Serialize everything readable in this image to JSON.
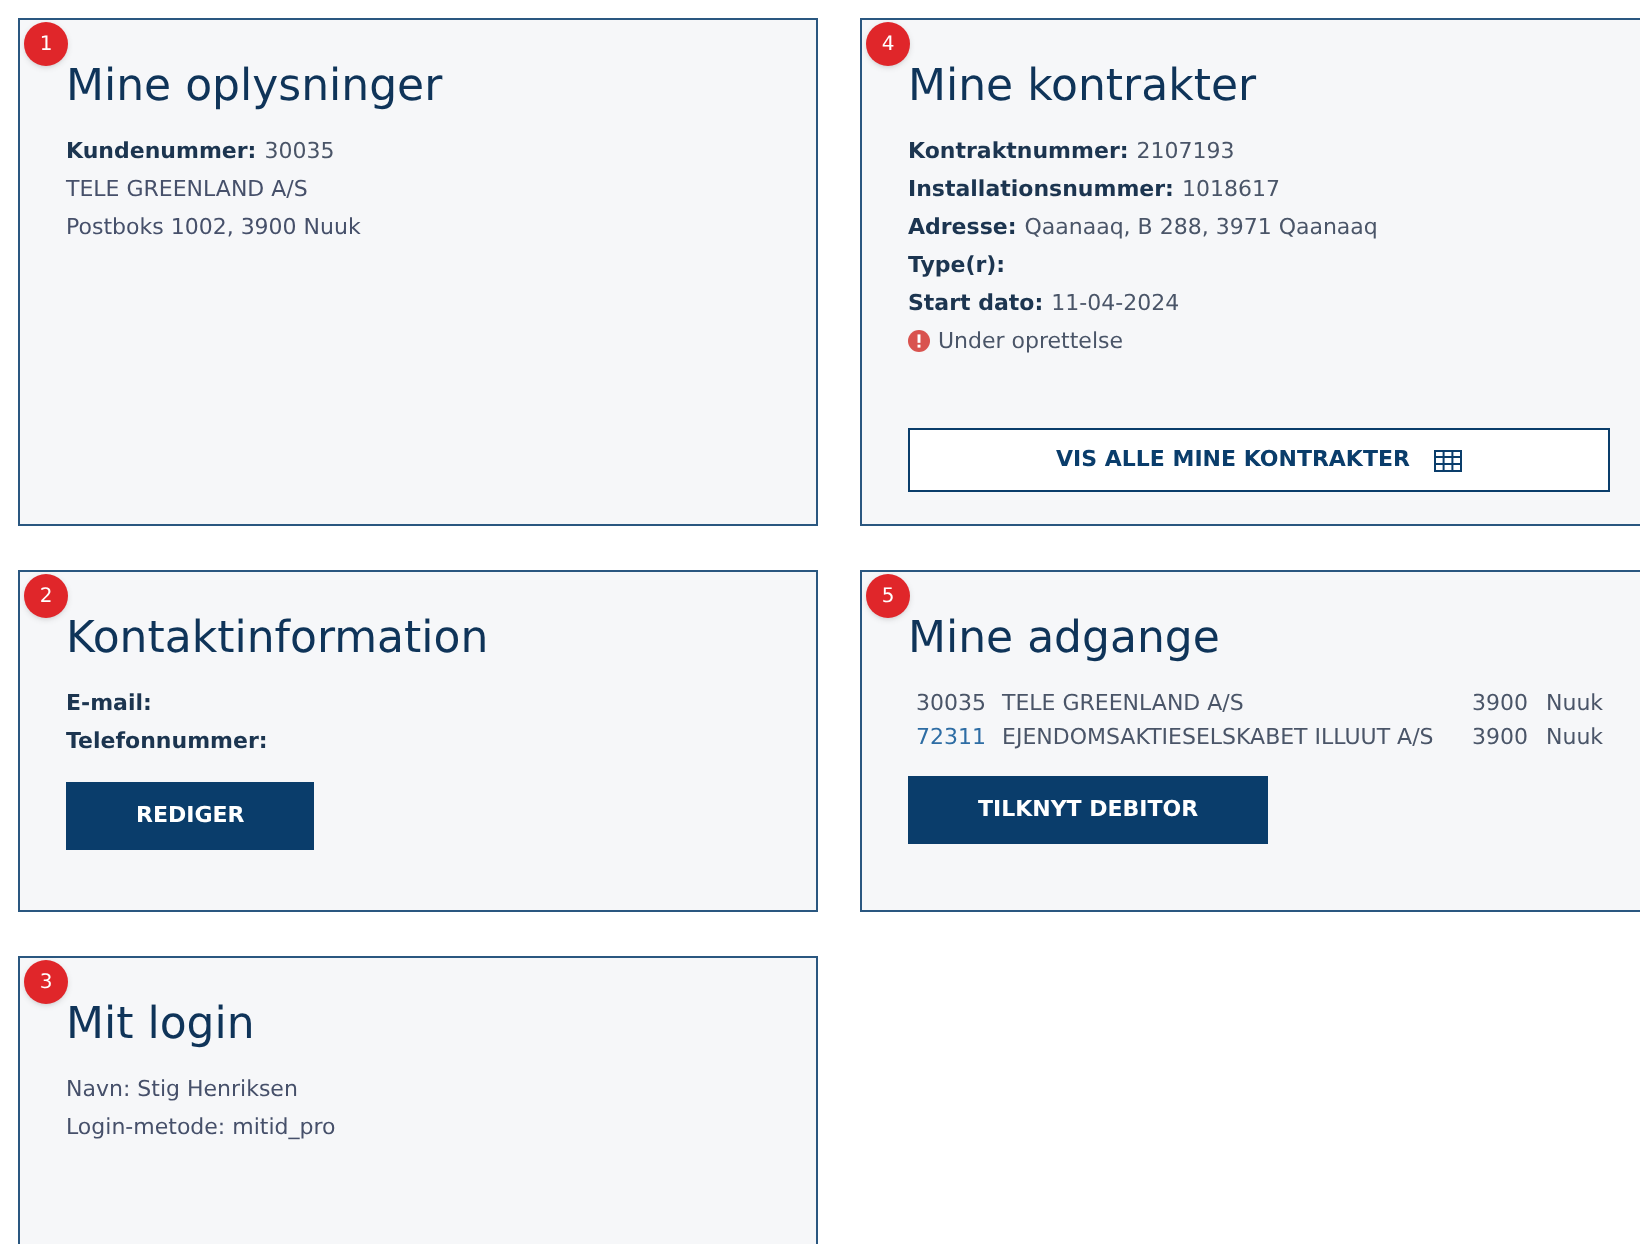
{
  "cards": [
    {
      "badge": "1",
      "title": "Mine oplysninger",
      "blocks": [
        {
          "kind": "field",
          "label": "Kundenummer:",
          "value": "30035"
        },
        {
          "kind": "text",
          "text": "TELE GREENLAND A/S"
        },
        {
          "kind": "text",
          "text": "Postboks 1002, 3900 Nuuk"
        }
      ]
    },
    {
      "badge": "4",
      "title": "Mine kontrakter",
      "blocks": [
        {
          "kind": "field",
          "label": "Kontraktnummer:",
          "value": "2107193"
        },
        {
          "kind": "field",
          "label": "Installationsnummer:",
          "value": "1018617"
        },
        {
          "kind": "field",
          "label": "Adresse:",
          "value": "Qaanaaq, B 288, 3971 Qaanaaq"
        },
        {
          "kind": "field",
          "label": "Type(r):"
        },
        {
          "kind": "field",
          "label": "Start dato:",
          "value": "11-04-2024"
        },
        {
          "kind": "status",
          "text": "Under oprettelse"
        },
        {
          "kind": "outline_button",
          "text": "VIS ALLE MINE KONTRAKTER"
        }
      ]
    },
    {
      "badge": "2",
      "title": "Kontaktinformation",
      "blocks": [
        {
          "kind": "field",
          "label": "E-mail:"
        },
        {
          "kind": "field",
          "label": "Telefonnummer:"
        },
        {
          "kind": "button",
          "text": "REDIGER"
        }
      ]
    },
    {
      "badge": "5",
      "title": "Mine adgange",
      "blocks": [
        {
          "kind": "table",
          "rows": [
            {
              "number": "30035",
              "link": false,
              "name": "TELE GREENLAND A/S",
              "postcode": "3900",
              "city": "Nuuk"
            },
            {
              "number": "72311",
              "link": true,
              "name": "EJENDOMSAKTIESELSKABET ILLUUT A/S",
              "postcode": "3900",
              "city": "Nuuk"
            }
          ]
        },
        {
          "kind": "button",
          "text": "TILKNYT DEBITOR"
        }
      ]
    },
    {
      "badge": "3",
      "title": "Mit login",
      "blocks": [
        {
          "kind": "text",
          "text": "Navn: Stig Henriksen"
        },
        {
          "kind": "text",
          "text": "Login-metode: mitid_pro"
        }
      ]
    }
  ]
}
